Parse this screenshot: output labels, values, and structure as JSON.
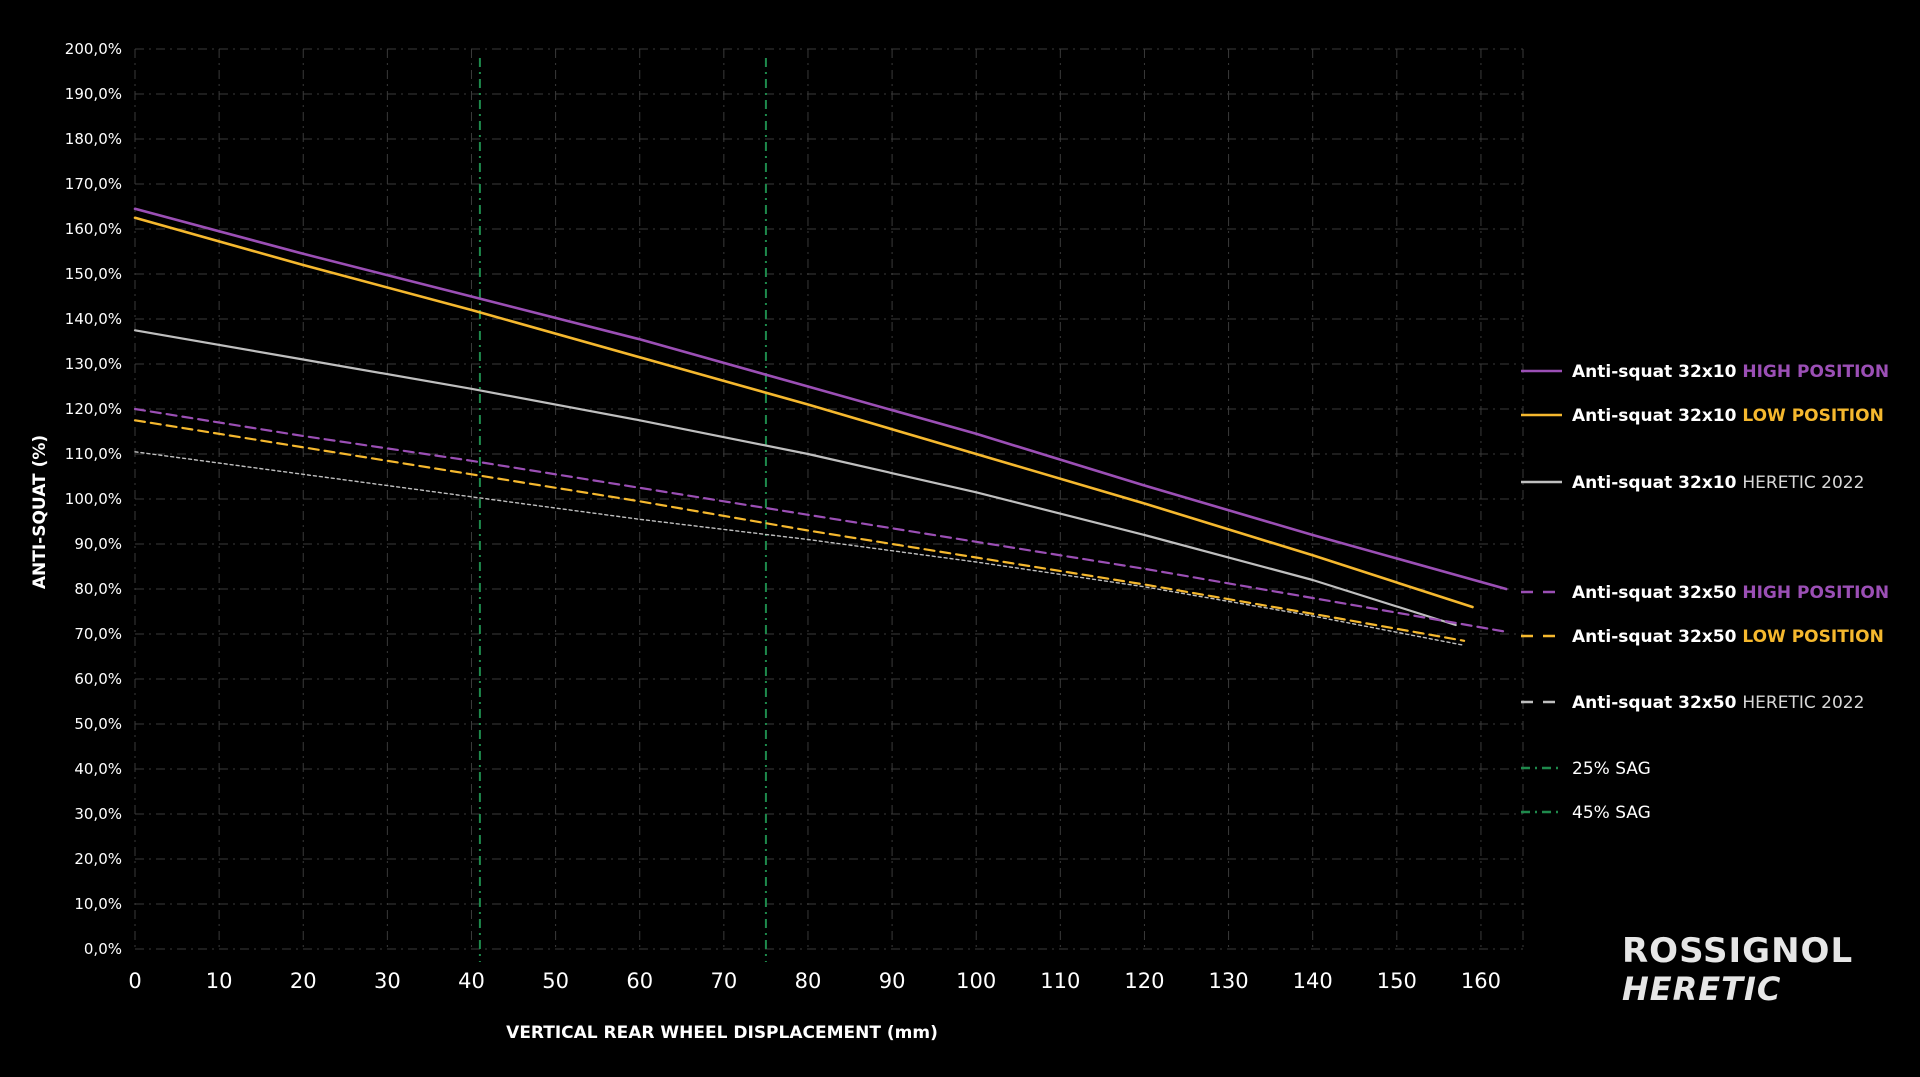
{
  "chart_data": {
    "type": "line",
    "xlabel": "VERTICAL REAR WHEEL DISPLACEMENT (mm)",
    "ylabel": "ANTI-SQUAT (%)",
    "xlim": [
      0,
      165
    ],
    "ylim": [
      0,
      200
    ],
    "x_ticks": [
      "0",
      "10",
      "20",
      "30",
      "40",
      "50",
      "60",
      "70",
      "80",
      "90",
      "100",
      "110",
      "120",
      "130",
      "140",
      "150",
      "160"
    ],
    "y_ticks": [
      "0,0%",
      "10,0%",
      "20,0%",
      "30,0%",
      "40,0%",
      "50,0%",
      "60,0%",
      "70,0%",
      "80,0%",
      "90,0%",
      "100,0%",
      "110,0%",
      "120,0%",
      "130,0%",
      "140,0%",
      "150,0%",
      "160,0%",
      "170,0%",
      "180,0%",
      "190,0%",
      "200,0%"
    ],
    "grid": true,
    "legend_position": "right",
    "series": [
      {
        "name": "Anti-squat 32x10 HIGH POSITION",
        "name_prefix": "Anti-squat 32x10",
        "name_suffix": "HIGH POSITION",
        "color": "#9b4fb5",
        "style": "solid",
        "x": [
          0,
          20,
          40,
          60,
          80,
          100,
          120,
          140,
          163
        ],
        "y": [
          164.5,
          154.5,
          145,
          135.5,
          125,
          114.5,
          103,
          92,
          80
        ]
      },
      {
        "name": "Anti-squat 32x10 LOW POSITION",
        "name_prefix": "Anti-squat 32x10",
        "name_suffix": "LOW POSITION",
        "color": "#f5b82e",
        "style": "solid",
        "x": [
          0,
          20,
          40,
          60,
          80,
          100,
          120,
          140,
          159
        ],
        "y": [
          162.5,
          152,
          142,
          131.5,
          121,
          110,
          99,
          87.5,
          76
        ]
      },
      {
        "name": "Anti-squat 32x10 HERETIC 2022",
        "name_prefix": "Anti-squat 32x10",
        "name_suffix": "HERETIC 2022",
        "color": "#bfbfbf",
        "style": "solid",
        "x": [
          0,
          20,
          40,
          60,
          80,
          100,
          120,
          140,
          157
        ],
        "y": [
          137.5,
          131,
          124.5,
          117.5,
          110,
          101.5,
          92,
          82,
          72
        ]
      },
      {
        "name": "Anti-squat 32x50 HIGH POSITION",
        "name_prefix": "Anti-squat 32x50",
        "name_suffix": "HIGH POSITION",
        "color": "#9b4fb5",
        "style": "dashed",
        "x": [
          0,
          20,
          40,
          60,
          80,
          100,
          120,
          140,
          163
        ],
        "y": [
          120,
          114,
          108.5,
          102.5,
          96.5,
          90.5,
          84.5,
          78,
          70.5
        ]
      },
      {
        "name": "Anti-squat 32x50 LOW POSITION",
        "name_prefix": "Anti-squat 32x50",
        "name_suffix": "LOW POSITION",
        "color": "#f5b82e",
        "style": "dashed",
        "x": [
          0,
          20,
          40,
          60,
          80,
          100,
          120,
          140,
          158
        ],
        "y": [
          117.5,
          111.5,
          105.5,
          99.5,
          93,
          87,
          81,
          74.5,
          68.5
        ]
      },
      {
        "name": "Anti-squat 32x50 HERETIC 2022",
        "name_prefix": "Anti-squat 32x50",
        "name_suffix": "HERETIC 2022",
        "color": "#bfbfbf",
        "style": "dotted",
        "x": [
          0,
          20,
          40,
          60,
          80,
          100,
          120,
          140,
          158
        ],
        "y": [
          110.5,
          105.5,
          100.5,
          95.5,
          91,
          86,
          80.5,
          74,
          67.5
        ]
      }
    ],
    "vlines": [
      {
        "name": "25% SAG",
        "x": 41,
        "color": "#1e8a4c",
        "style": "dashdot"
      },
      {
        "name": "45% SAG",
        "x": 75,
        "color": "#1e8a4c",
        "style": "dashdot"
      }
    ]
  },
  "logo": {
    "brand": "ROSSIGNOL",
    "model": "HERETIC"
  }
}
